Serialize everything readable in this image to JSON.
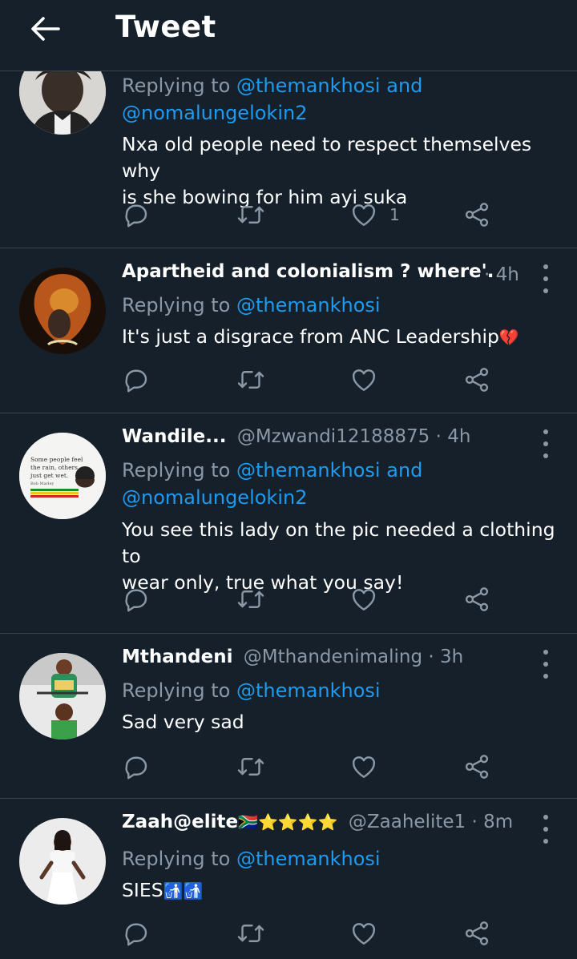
{
  "header": {
    "title": "Tweet"
  },
  "tweets": [
    {
      "name": "",
      "handle": "",
      "time": "",
      "reply_prefix": "Replying to",
      "mention1": "@themankhosi",
      "and": "and",
      "mention2": "@nomalungelokin2",
      "text_lines": [
        "Nxa old people need to respect themselves why",
        "is she bowing for him ayi suka"
      ],
      "like_count": "1"
    },
    {
      "name": "Apartheid and colonialism ? where'...",
      "time": "· 4h",
      "reply_prefix": "Replying to",
      "mention1": "@themankhosi",
      "text": "It's just a disgrace from ANC Leadership",
      "text_emoji": "💔"
    },
    {
      "name": "Wandile...",
      "handle": "@Mzwandi12188875",
      "time": "· 4h",
      "reply_prefix": "Replying to",
      "mention1": "@themankhosi",
      "and": "and",
      "mention2": "@nomalungelokin2",
      "text_lines": [
        "You see this lady on the pic needed a clothing to",
        "wear only, true what you say!"
      ],
      "avatar_text": [
        "Some people feel",
        "the rain, others",
        "just get wet.",
        "Bob Marley"
      ]
    },
    {
      "name": "Mthandeni",
      "handle": "@Mthandenimaling",
      "time": "· 3h",
      "reply_prefix": "Replying to",
      "mention1": "@themankhosi",
      "text": "Sad very sad"
    },
    {
      "name": "Zaah@elite",
      "name_emoji": "🇿🇦⭐⭐⭐⭐",
      "handle": "@Zaahelite1",
      "time": "· 8m",
      "reply_prefix": "Replying to",
      "mention1": "@themankhosi",
      "text": "SIES",
      "text_emoji": "🚮🚮"
    }
  ],
  "colors": {
    "background": "#15202b",
    "accent": "#1d9bf0",
    "muted": "#8b98a5",
    "divider": "#38444d",
    "heart_break": "#e0245e"
  },
  "icons": [
    "back-arrow-icon",
    "reply-icon",
    "retweet-icon",
    "like-icon",
    "share-icon",
    "more-icon"
  ]
}
